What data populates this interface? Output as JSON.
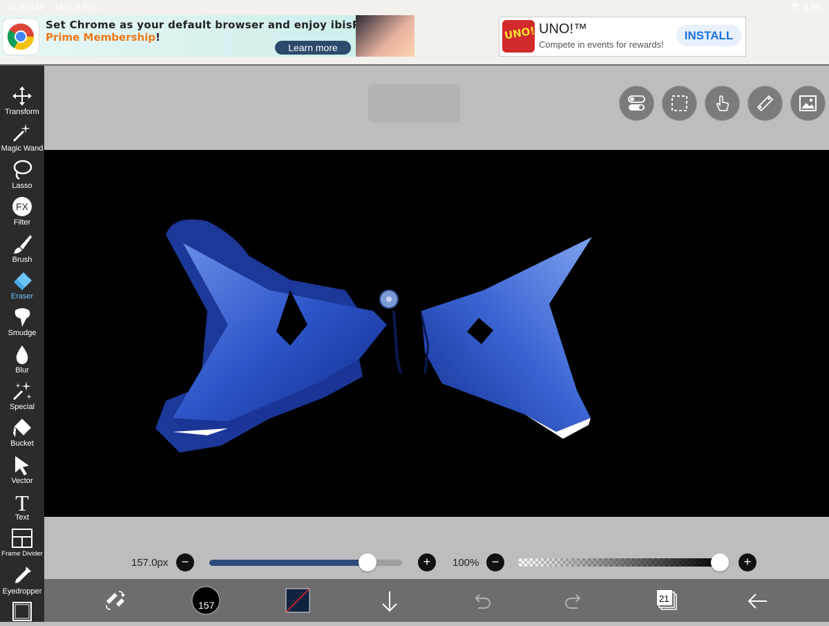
{
  "status": {
    "time": "10:20 AM",
    "date": "Mon 9 Feb",
    "battery": "13%"
  },
  "ad_chrome": {
    "line1": "Set Chrome as your default browser and enjoy ibisPaint",
    "line2_highlight": "Prime Membership",
    "line2_suffix": "!",
    "cta": "Learn more"
  },
  "ad_uno": {
    "logo_text": "UNO!",
    "title": "UNO!™",
    "subtitle": "Compete in events for rewards!",
    "cta": "INSTALL"
  },
  "tools": [
    {
      "label": "Transform",
      "icon": "move-icon"
    },
    {
      "label": "Magic Wand",
      "icon": "magic-wand-icon"
    },
    {
      "label": "Lasso",
      "icon": "lasso-icon"
    },
    {
      "label": "Filter",
      "icon": "fx-icon"
    },
    {
      "label": "Brush",
      "icon": "brush-icon"
    },
    {
      "label": "Eraser",
      "icon": "eraser-icon",
      "active": true
    },
    {
      "label": "Smudge",
      "icon": "smudge-icon"
    },
    {
      "label": "Blur",
      "icon": "blur-drop-icon"
    },
    {
      "label": "Special",
      "icon": "sparkle-icon"
    },
    {
      "label": "Bucket",
      "icon": "bucket-icon"
    },
    {
      "label": "Vector",
      "icon": "vector-arrow-icon"
    },
    {
      "label": "Text",
      "icon": "text-icon"
    },
    {
      "label": "Frame Divider",
      "icon": "frame-divider-icon"
    },
    {
      "label": "Eyedropper",
      "icon": "eyedropper-icon"
    }
  ],
  "colors": {
    "accent": "#6cc3ff",
    "toolbar": "#2b2b2b",
    "slider_fill": "#2d4a7c",
    "artwork": "#2e56c9"
  },
  "brush": {
    "size_label": "157.0px",
    "size_fraction": 0.82,
    "opacity_label": "100%",
    "opacity_fraction": 1.0,
    "size_badge": "157"
  },
  "bottom": {
    "layers_count": "21"
  },
  "top_buttons": [
    "toggle-icon",
    "selection-icon",
    "touch-icon",
    "ruler-icon",
    "image-icon"
  ]
}
